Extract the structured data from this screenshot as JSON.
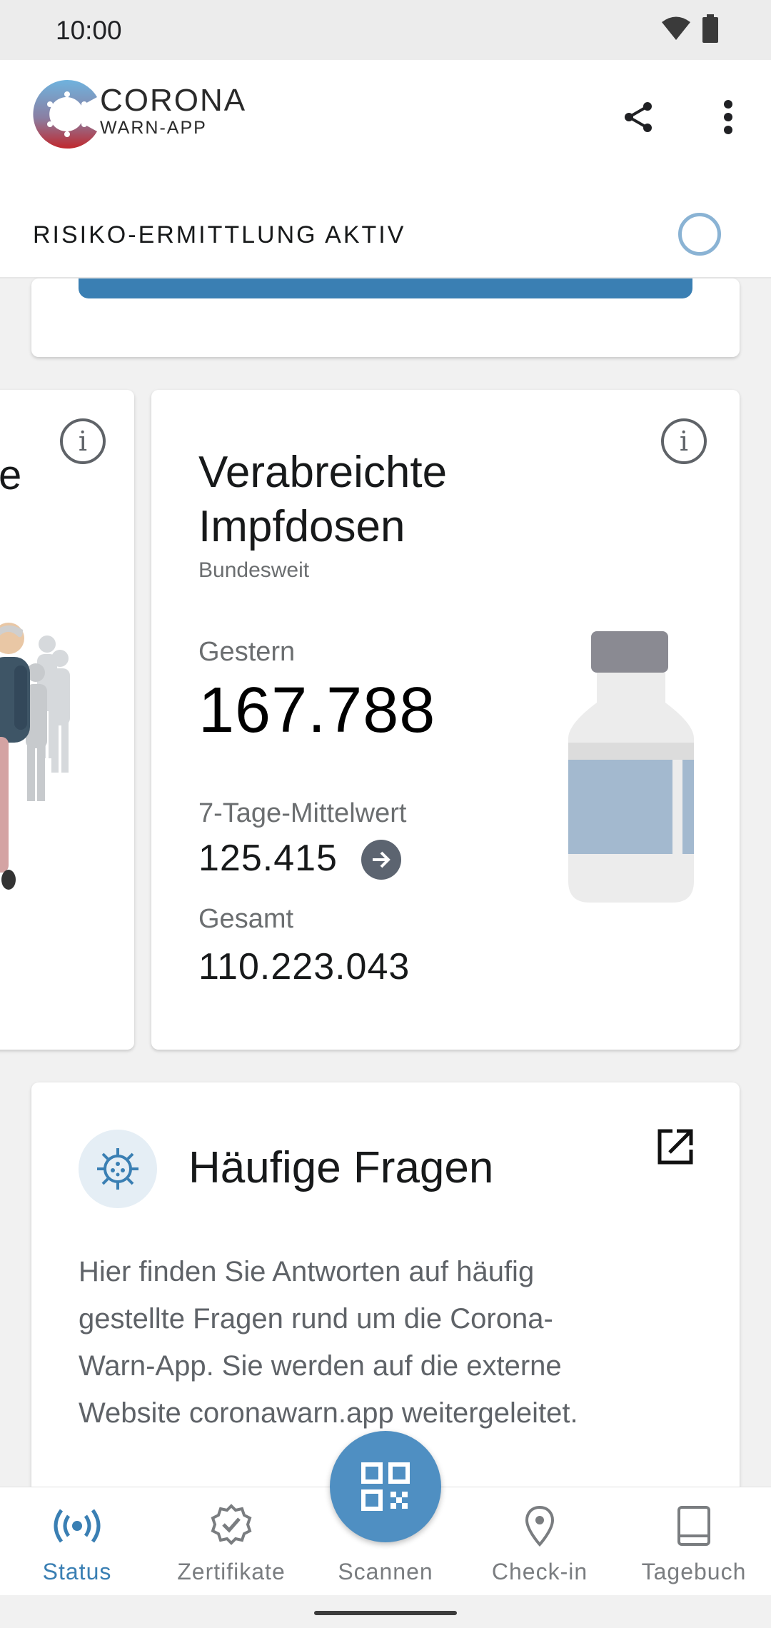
{
  "status_bar": {
    "time": "10:00"
  },
  "app_header": {
    "logo_line1": "CORONA",
    "logo_line2": "WARN-APP",
    "risk_status": "RISIKO-ERMITTLUNG AKTIV"
  },
  "stats_left": {
    "partial_title": "e"
  },
  "vaccination_card": {
    "title": "Verabreichte Impfdosen",
    "subtitle": "Bundesweit",
    "yesterday_label": "Gestern",
    "yesterday_value": "167.788",
    "avg_label": "7-Tage-Mittelwert",
    "avg_value": "125.415",
    "total_label": "Gesamt",
    "total_value": "110.223.043"
  },
  "faq_card": {
    "title": "Häufige Fragen",
    "body": "Hier finden Sie Antworten auf häufig gestellte Fragen rund um die Corona-Warn-App. Sie werden auf die externe Website coronawarn.app weitergeleitet."
  },
  "bottom_nav": {
    "items": [
      {
        "label": "Status",
        "icon": "broadcast-icon"
      },
      {
        "label": "Zertifikate",
        "icon": "certificate-icon"
      },
      {
        "label": "Scannen",
        "icon": "qr-code-icon"
      },
      {
        "label": "Check-in",
        "icon": "location-pin-icon"
      },
      {
        "label": "Tagebuch",
        "icon": "book-icon"
      }
    ]
  },
  "colors": {
    "accent": "#3a7fb3",
    "fab": "#4f8fc2",
    "risk_ring": "#8ab3d4"
  }
}
